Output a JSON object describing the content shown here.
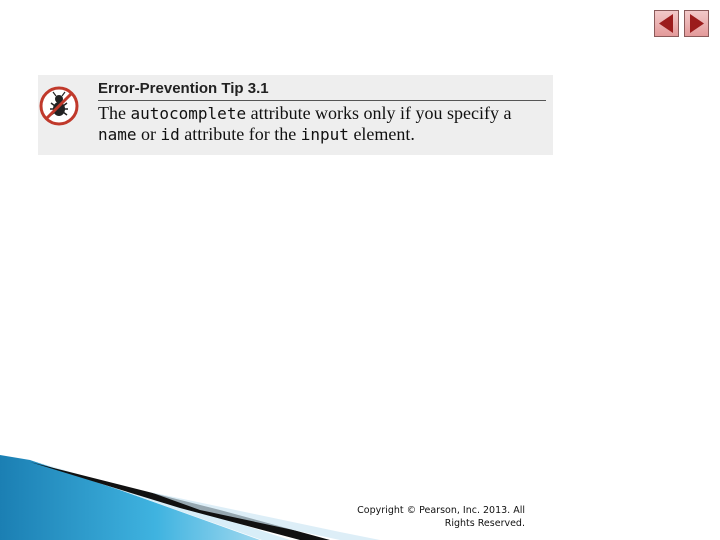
{
  "nav": {
    "prev_icon": "triangle-left-icon",
    "next_icon": "triangle-right-icon"
  },
  "tip": {
    "title": "Error-Prevention Tip 3.1",
    "icon": "bug-prohibited-icon",
    "text": {
      "part1": "The ",
      "code1": "autocomplete",
      "part2": " attribute works only if you specify a ",
      "code2": "name",
      "part3": " or ",
      "code3": "id",
      "part4": " attribute for the ",
      "code4": "input",
      "part5": " element."
    }
  },
  "footer": {
    "copyright": "Copyright © Pearson, Inc. 2013. All Rights Reserved."
  },
  "colors": {
    "tip_background": "#eeeeee",
    "nav_button": "#e39a9a",
    "swoosh_blue": "#2aa3d6"
  }
}
